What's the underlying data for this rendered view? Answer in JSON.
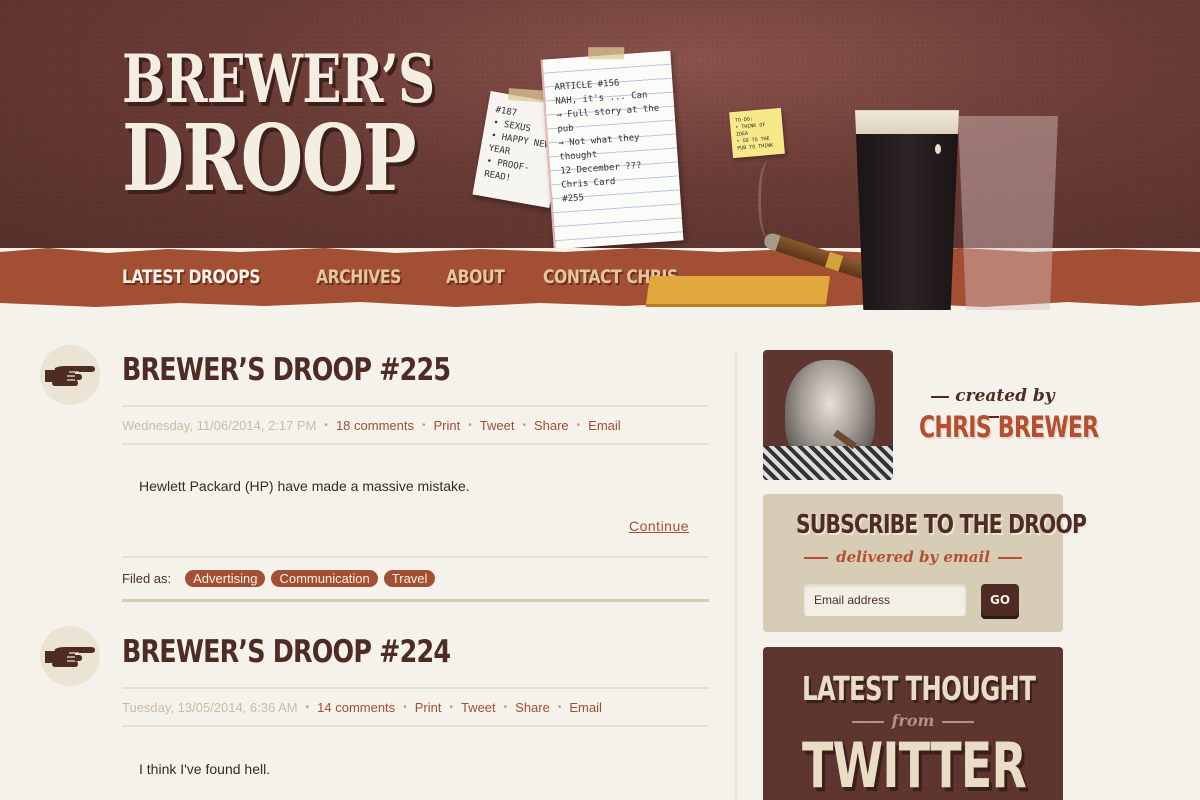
{
  "site": {
    "logo_line1": "BREWER’S",
    "logo_line2": "DROOP"
  },
  "nav": {
    "items": [
      {
        "label": "LATEST DROOPS",
        "active": true
      },
      {
        "label": "ARCHIVES",
        "active": false
      },
      {
        "label": "ABOUT",
        "active": false
      },
      {
        "label": "CONTACT CHRIS",
        "active": false
      }
    ]
  },
  "header_art": {
    "note_small_text": "#187\n• SEXUS\n• HAPPY NEW YEAR\n• PROOF-READ!",
    "note_large_text": "ARTICLE #156\nNAH, it's ... Can\n→ Full story at the pub\n→ Not what they thought\n12 December ???\nChris   Card\n#255",
    "sticky_text": "TO-DO:\n• THINK OF IDEA\n• GO TO THE PUB TO THINK"
  },
  "posts": [
    {
      "title": "BREWER’S DROOP #225",
      "date": "Wednesday, 11/06/2014, 2:17 PM",
      "comments": "18 comments",
      "actions": [
        "Print",
        "Tweet",
        "Share",
        "Email"
      ],
      "excerpt": "Hewlett Packard (HP) have made a massive mistake.",
      "continue_label": "Continue",
      "filed_label": "Filed as:",
      "tags": [
        "Advertising",
        "Communication",
        "Travel"
      ]
    },
    {
      "title": "BREWER’S DROOP #224",
      "date": "Tuesday, 13/05/2014, 6:36 AM",
      "comments": "14 comments",
      "actions": [
        "Print",
        "Tweet",
        "Share",
        "Email"
      ],
      "excerpt": "I think I've found hell."
    }
  ],
  "sidebar": {
    "created_by": "created by",
    "author": "CHRIS BREWER",
    "subscribe": {
      "title": "SUBSCRIBE TO THE DROOP",
      "subtitle": "delivered by email",
      "email_placeholder": "Email address",
      "go_label": "GO"
    },
    "twitter": {
      "line1": "LATEST THOUGHT",
      "line2": "from",
      "line3": "TWITTER"
    }
  },
  "colors": {
    "header_brown": "#6b3c36",
    "nav_rust": "#a24f34",
    "page_bg": "#f5f2ec",
    "title_brown": "#4e2c25",
    "link_rust": "#a24f34",
    "subscribe_bg": "#d7ccb5"
  }
}
